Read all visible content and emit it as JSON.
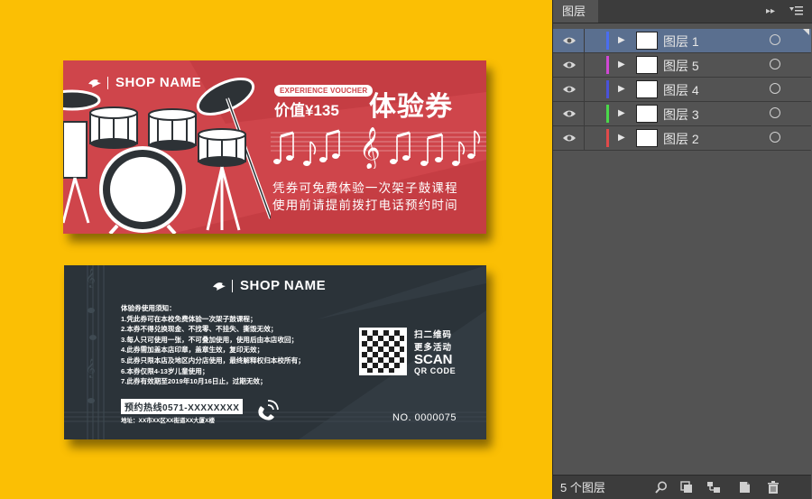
{
  "voucher_front": {
    "shop_name": "SHOP NAME",
    "pill": "EXPERIENCE VOUCHER",
    "value": "价值¥135",
    "title": "体验券",
    "line1": "凭券可免费体验一次架子鼓课程",
    "line2": "使用前请提前拨打电话预约时间"
  },
  "voucher_back": {
    "shop_name": "SHOP NAME",
    "rules": [
      "体验券使用须知：",
      "1.凭此券可在本校免费体验一次架子鼓课程；",
      "2.本券不得兑换现金、不找零、不挂失、撕毁无效；",
      "3.每人只可使用一张，不可叠加使用，使用后由本店收回；",
      "4.此券需加盖本店印章，盖章生效，复印无效；",
      "5.此券只限本店及地区内分店使用，最终解释权归本校所有；",
      "6.本券仅限4-13岁儿童使用；",
      "7.此券有效期至2019年10月16日止，过期无效；"
    ],
    "hotline": "预约热线0571-XXXXXXXX",
    "address": "地址：XX市XX区XX街道XX大厦X楼",
    "scan_line1": "扫二维码",
    "scan_line2": "更多活动",
    "scan_line3": "SCAN",
    "scan_line4": "QR CODE",
    "number": "NO. 0000075"
  },
  "panel": {
    "tab": "图层",
    "menu_arrows": "▸▸",
    "menu_icon": "hamburger-icon",
    "layer_count": "5 个图层",
    "layers": [
      {
        "name": "图层 1",
        "color": "#4a6df0",
        "selected": true
      },
      {
        "name": "图层 5",
        "color": "#d048d4",
        "selected": false
      },
      {
        "name": "图层 4",
        "color": "#4a52d8",
        "selected": false
      },
      {
        "name": "图层 3",
        "color": "#4ad84a",
        "selected": false
      },
      {
        "name": "图层 2",
        "color": "#e04a4a",
        "selected": false
      }
    ],
    "footer_icons": [
      "search-icon",
      "clipping-mask-icon",
      "sublayer-icon",
      "new-layer-icon",
      "delete-icon"
    ]
  }
}
